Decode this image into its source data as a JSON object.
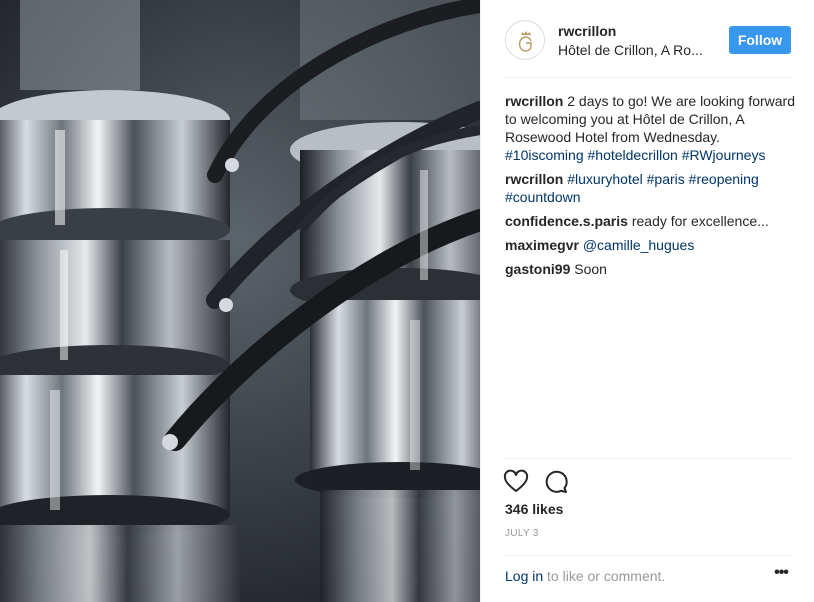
{
  "post": {
    "image_subject": "stacked stainless steel saucepans",
    "header": {
      "username": "rwcrillon",
      "location": "Hôtel de Crillon, A Ro...",
      "follow_label": "Follow",
      "avatar_icon": "crillon-logo-icon"
    },
    "caption": {
      "author": "rwcrillon",
      "text": "2 days to go! We are looking forward to welcoming you at Hôtel de Crillon, A Rosewood Hotel from Wednesday.",
      "tags": [
        "#10iscoming",
        "#hoteldecrillon",
        "#RWjourneys"
      ]
    },
    "comments": [
      {
        "author": "rwcrillon",
        "text": "",
        "tags": [
          "#luxuryhotel",
          "#paris",
          "#reopening",
          "#countdown"
        ]
      },
      {
        "author": "confidence.s.paris",
        "text": "ready for excellence...",
        "tags": []
      },
      {
        "author": "maximegvr",
        "text": "",
        "tags": [
          "@camille_hugues"
        ]
      },
      {
        "author": "gastoni99",
        "text": "Soon",
        "tags": []
      }
    ],
    "actions": {
      "like_icon": "heart-icon",
      "comment_icon": "comment-bubble-icon",
      "likes": "346 likes",
      "date": "JULY 3",
      "login_link": "Log in",
      "login_rest": " to like or comment.",
      "more_icon": "more-options-icon",
      "more_label": "•••"
    }
  },
  "colors": {
    "follow_button": "#3897f0",
    "hashtag": "#003569",
    "muted": "#999999",
    "border": "#efefef"
  }
}
